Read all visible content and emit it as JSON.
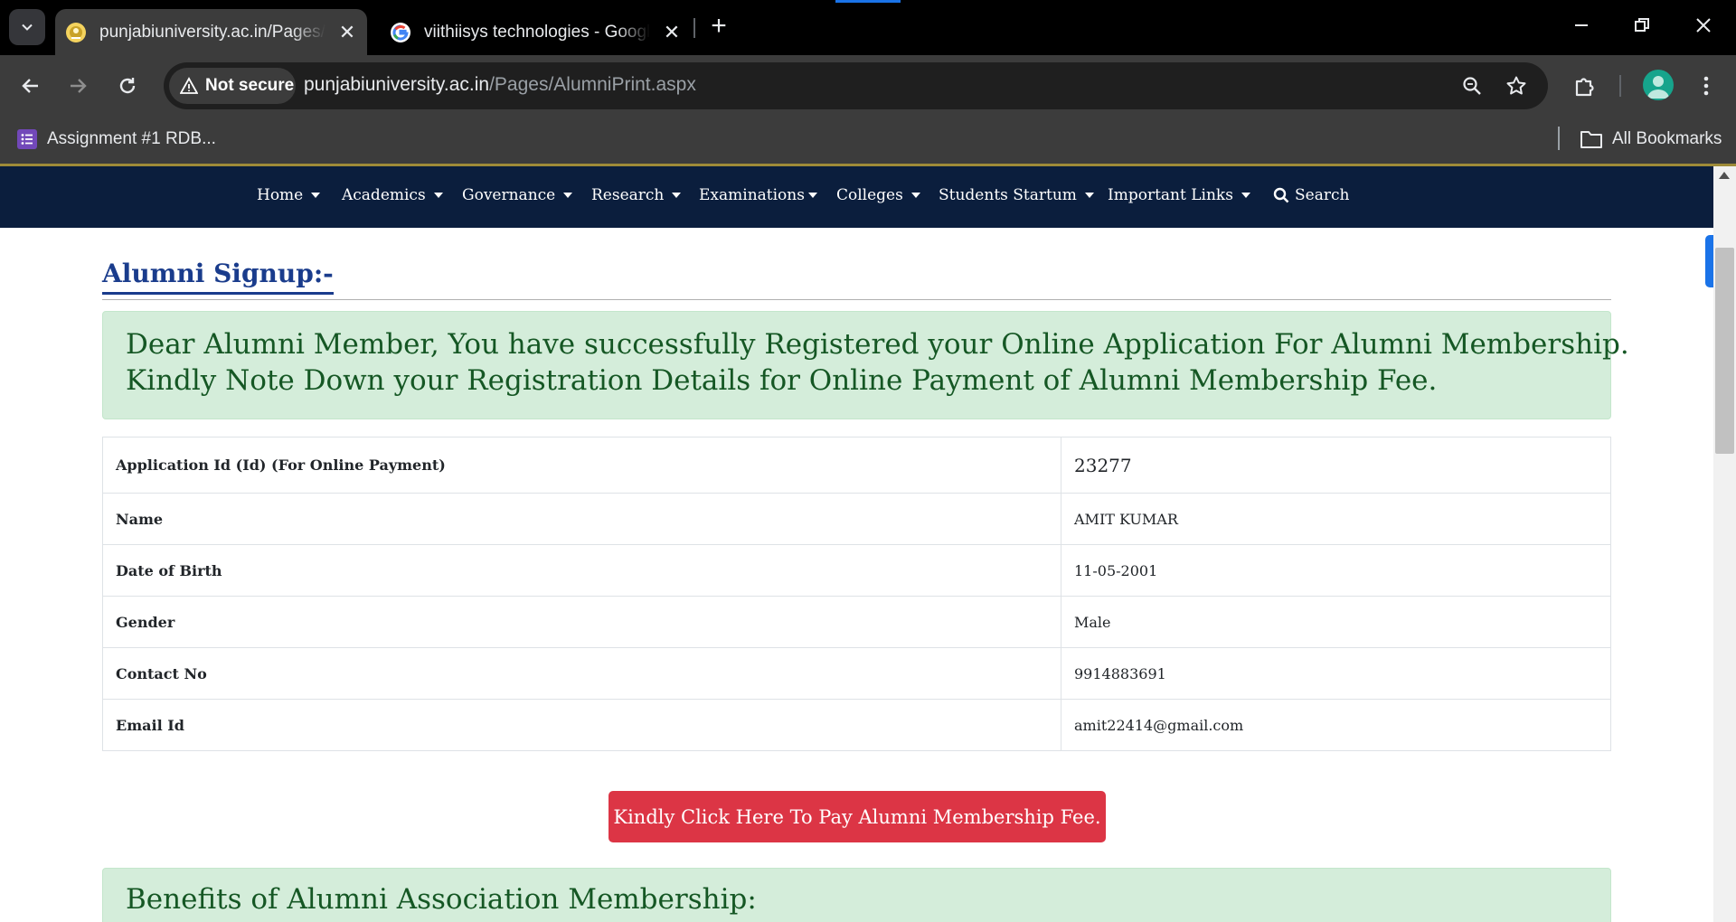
{
  "browser": {
    "tabs": [
      {
        "title": "punjabiuniversity.ac.in/Pages/AlumniPrint.aspx",
        "active": true,
        "close": "✕"
      },
      {
        "title": "viithiisys technologies - Google Search",
        "active": false,
        "close": "✕"
      }
    ],
    "new_tab": "+",
    "security_label": "Not secure",
    "url_host": "punjabiuniversity.ac.in",
    "url_path": "/Pages/AlumniPrint.aspx",
    "bookmark": "Assignment #1 RDB...",
    "all_bookmarks": "All Bookmarks"
  },
  "site_nav": {
    "items": [
      {
        "label": "Home"
      },
      {
        "label": "Academics"
      },
      {
        "label": "Governance"
      },
      {
        "label": "Research"
      },
      {
        "label": "Examinations"
      },
      {
        "label": "Colleges"
      },
      {
        "label": "Students Startum"
      },
      {
        "label": "Important Links"
      }
    ],
    "search_label": "Search"
  },
  "page": {
    "title": "Alumni Signup:-",
    "alert_line1": "Dear Alumni Member, You have successfully Registered your Online Application For Alumni Membership.",
    "alert_line2": "Kindly Note Down your Registration Details for Online Payment of Alumni Membership Fee.",
    "details": [
      {
        "label": "Application Id (Id) (For Online Payment)",
        "value": "23277"
      },
      {
        "label": "Name",
        "value": "AMIT KUMAR"
      },
      {
        "label": "Date of Birth",
        "value": "11-05-2001"
      },
      {
        "label": "Gender",
        "value": "Male"
      },
      {
        "label": "Contact No",
        "value": "9914883691"
      },
      {
        "label": "Email Id",
        "value": "amit22414@gmail.com"
      }
    ],
    "pay_button": "Kindly Click Here To Pay Alumni Membership Fee.",
    "benefits_title": "Benefits of Alumni Association Membership:"
  },
  "colors": {
    "nav_bg": "#0b1e3d",
    "title": "#1a3c8c",
    "alert_bg": "#d4edda",
    "alert_text": "#155724",
    "pay_button": "#dc3545"
  }
}
